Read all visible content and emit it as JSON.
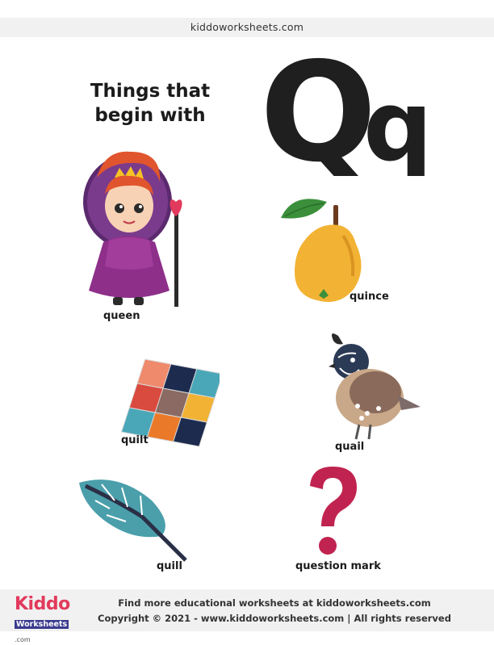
{
  "header": {
    "site": "kiddoworksheets.com"
  },
  "title": {
    "line1": "Things that",
    "line2": "begin with"
  },
  "letters": {
    "upper": "Q",
    "lower": "q"
  },
  "items": [
    {
      "label": "queen"
    },
    {
      "label": "quince"
    },
    {
      "label": "quilt"
    },
    {
      "label": "quail"
    },
    {
      "label": "quill"
    },
    {
      "label": "question mark"
    }
  ],
  "footer": {
    "logo_top": "Kiddo",
    "logo_bottom": "Worksheets",
    "logo_com": ".com",
    "line1": "Find more educational worksheets at kiddoworksheets.com",
    "line2": "Copyright © 2021 - www.kiddoworksheets.com  |  All rights reserved"
  },
  "colors": {
    "letter": "#1f1f1f",
    "quince": "#f2b233",
    "question": "#c0234f",
    "quill": "#4a9fab"
  }
}
